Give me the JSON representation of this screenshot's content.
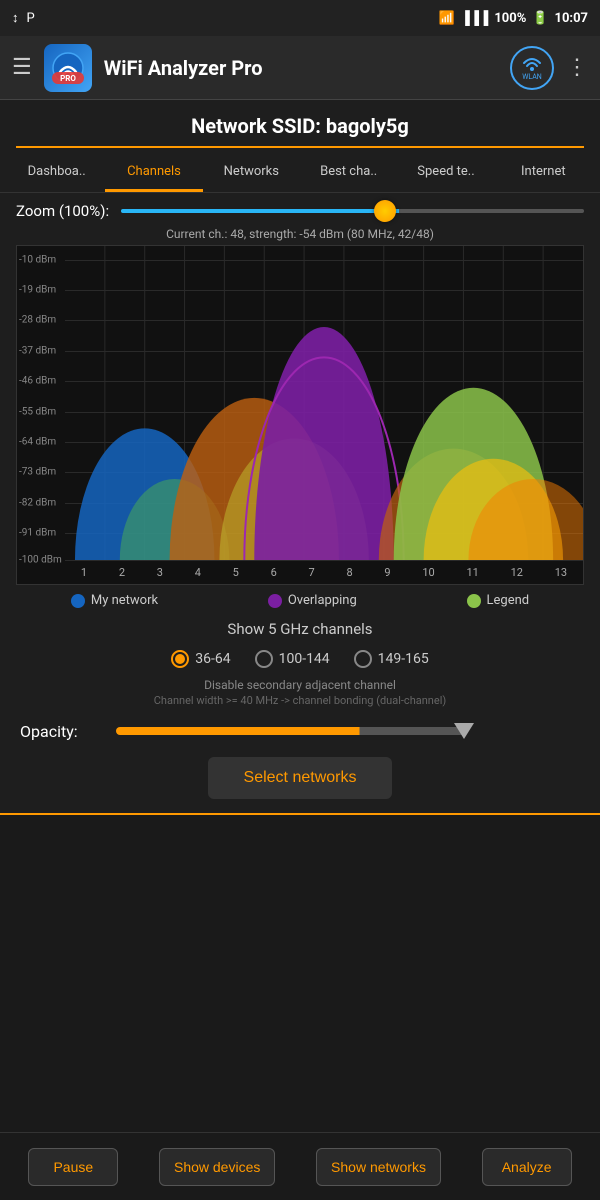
{
  "status_bar": {
    "left_icons": [
      "↕",
      "P"
    ],
    "wifi": "WiFi",
    "signal": "▐▐▐▌",
    "battery": "100%",
    "time": "10:07"
  },
  "top_bar": {
    "hamburger": "☰",
    "app_name": "WiFi Analyzer Pro",
    "wlan_label": "WLAN",
    "more": "⋮"
  },
  "network": {
    "title": "Network SSID: bagoly5g"
  },
  "tabs": [
    {
      "id": "dashboard",
      "label": "Dashboa..",
      "active": false
    },
    {
      "id": "channels",
      "label": "Channels",
      "active": true
    },
    {
      "id": "networks",
      "label": "Networks",
      "active": false
    },
    {
      "id": "best_channel",
      "label": "Best cha..",
      "active": false
    },
    {
      "id": "speed_test",
      "label": "Speed te..",
      "active": false
    },
    {
      "id": "internet",
      "label": "Internet",
      "active": false
    }
  ],
  "zoom": {
    "label": "Zoom (100%):",
    "value": 100
  },
  "channel_info": "Current ch.: 48, strength: -54 dBm (80 MHz, 42/48)",
  "chart": {
    "y_labels": [
      "-10 dBm",
      "-19 dBm",
      "-28 dBm",
      "-37 dBm",
      "-46 dBm",
      "-55 dBm",
      "-64 dBm",
      "-73 dBm",
      "-82 dBm",
      "-91 dBm",
      "-100 dBm"
    ],
    "x_labels": [
      "1",
      "2",
      "3",
      "4",
      "5",
      "6",
      "7",
      "8",
      "9",
      "10",
      "11",
      "12",
      "13"
    ]
  },
  "legend": {
    "my_network_label": "My network",
    "overlapping_label": "Overlapping",
    "legend_label": "Legend"
  },
  "ghz_section": {
    "title": "Show 5 GHz channels",
    "options": [
      {
        "value": "36-64",
        "label": "36-64",
        "checked": true
      },
      {
        "value": "100-144",
        "label": "100-144",
        "checked": false
      },
      {
        "value": "149-165",
        "label": "149-165",
        "checked": false
      }
    ]
  },
  "disable_secondary": "Disable secondary adjacent channel",
  "channel_width_note": "Channel width >= 40 MHz -> channel bonding (dual-channel)",
  "opacity": {
    "label": "Opacity:"
  },
  "select_networks_btn": "Select networks",
  "bottom_buttons": [
    {
      "id": "pause",
      "label": "Pause"
    },
    {
      "id": "show_devices",
      "label": "Show devices"
    },
    {
      "id": "show_networks",
      "label": "Show networks"
    },
    {
      "id": "analyze",
      "label": "Analyze"
    }
  ]
}
